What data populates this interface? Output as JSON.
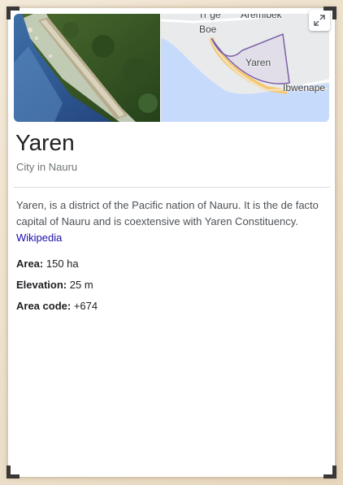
{
  "place": {
    "title": "Yaren",
    "subtitle": "City in Nauru",
    "description": "Yaren, is a district of the Pacific nation of Nauru. It is the de facto capital of Nauru and is coextensive with Yaren Constituency.",
    "source_link": "Wikipedia"
  },
  "map": {
    "labels": {
      "top_partial_left": "Tr ge",
      "top_partial_right": "Aremibek",
      "boe": "Boe",
      "yaren": "Yaren",
      "ibwenape": "Ibwenape"
    },
    "expand_icon": "expand-icon",
    "colors": {
      "land": "#e9eaec",
      "sea": "#c6dafc",
      "road": "#f5c874",
      "boundary": "#7b5ea7"
    }
  },
  "facts": [
    {
      "label": "Area:",
      "value": "150 ha"
    },
    {
      "label": "Elevation:",
      "value": "25 m"
    },
    {
      "label": "Area code:",
      "value": "+674"
    }
  ],
  "colors": {
    "title": "#202124",
    "link": "#1a0dab",
    "muted": "#70757a"
  }
}
